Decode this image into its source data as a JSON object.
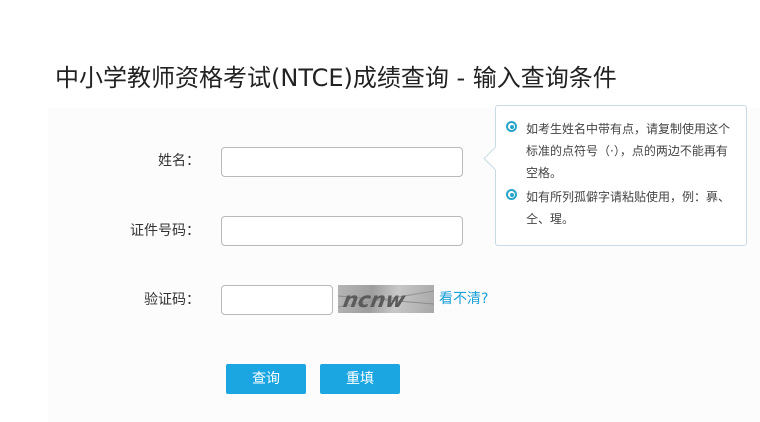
{
  "page": {
    "title": "中小学教师资格考试(NTCE)成绩查询 - 输入查询条件"
  },
  "form": {
    "name_label": "姓名：",
    "name_value": "",
    "id_label": "证件号码：",
    "id_value": "",
    "captcha_label": "验证码：",
    "captcha_value": "",
    "captcha_image_text": "ncnw",
    "captcha_refresh": "看不清?"
  },
  "buttons": {
    "query": "查询",
    "reset": "重填"
  },
  "tips": [
    "如考生姓名中带有点，请复制使用这个标准的点符号（·），点的两边不能再有空格。",
    "如有所列孤僻字请粘贴使用，例：奡、仝、瑆。"
  ],
  "colors": {
    "accent": "#1ba6e2",
    "link": "#1aa0d8",
    "tip_bullet": "#27a4c8"
  },
  "icons": {
    "tip_bullet": "radio-bullet-icon"
  }
}
